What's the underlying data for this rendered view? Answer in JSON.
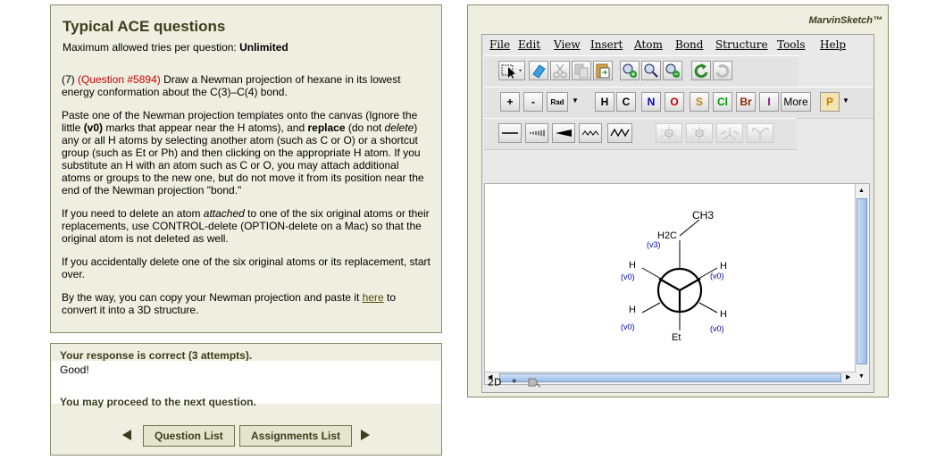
{
  "question": {
    "title": "Typical ACE questions",
    "max_tries_label": "Maximum allowed tries per question:",
    "max_tries_value": "Unlimited",
    "number": "(7)",
    "qid": "(Question #5894)",
    "p1": "Draw a Newman projection of hexane in its lowest energy conformation about the C(3)–C(4) bond.",
    "p2a": "Paste one of the Newman projection templates onto the canvas (Ignore the little ",
    "p2b": "(v0)",
    "p2c": " marks that appear near the H atoms), and ",
    "p2d": "replace",
    "p2e": " (do not ",
    "p2f": "delete",
    "p2g": ") any or all H atoms by selecting another atom (such as C or O) or a shortcut group (such as Et or Ph) and then clicking on the appropriate H atom. If you substitute an H with an atom such as C or O, you may attach additional atoms or groups to the new one, but do not move it from its position near the end of the Newman projection \"bond.\"",
    "p3a": "If you need to delete an atom ",
    "p3b": "attached",
    "p3c": " to one of the six original atoms or their replacements, use CONTROL-delete (OPTION-delete on a Mac) so that the original atom is not deleted as well.",
    "p4": "If you accidentally delete one of the six original atoms or its replacement, start over.",
    "p5a": "By the way, you can copy your Newman projection and paste it ",
    "p5link": "here",
    "p5b": " to convert it into a 3D structure."
  },
  "feedback": {
    "status": "Your response is correct (3 attempts).",
    "message": "Good!",
    "proceed": "You may proceed to the next question.",
    "question_list_label": "Question List",
    "assignments_list_label": "Assignments List"
  },
  "marvin": {
    "brand": "MarvinSketch™",
    "menus": [
      "File",
      "Edit",
      "View",
      "Insert",
      "Atom",
      "Bond",
      "Structure",
      "Tools",
      "Help"
    ],
    "element_buttons": [
      "H",
      "C",
      "N",
      "O",
      "S",
      "Cl",
      "Br",
      "I"
    ],
    "more_label": "More",
    "p_label": "P",
    "rad_label": "Rad",
    "plus_label": "+",
    "minus_label": "-",
    "status_mode": "2D",
    "status_star": "*",
    "molecule": {
      "ch3": "CH3",
      "h2c": "H2C",
      "v3": "(v3)",
      "v0": "(v0)",
      "h": "H",
      "et": "Et"
    },
    "colors": {
      "n": "#0000cc",
      "o": "#cc0000",
      "s": "#b8860b",
      "cl": "#009900",
      "br": "#8b2500",
      "i": "#8a008a",
      "p": "#cc7a00",
      "vlabel": "#0000aa"
    }
  }
}
